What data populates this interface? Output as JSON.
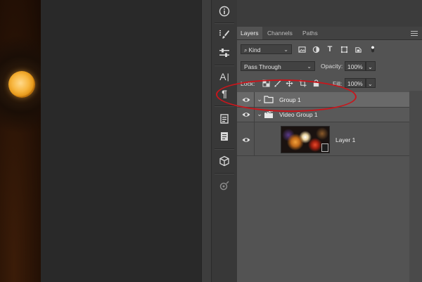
{
  "canvas": {
    "photo_desc_colors": {
      "orb": "#f3b13a",
      "background": "#080503"
    }
  },
  "toolstrip": {
    "tools": [
      {
        "name": "info-icon"
      },
      {
        "name": "brush-presets-icon"
      },
      {
        "name": "adjustment-sliders-icon"
      },
      {
        "name": "character-icon",
        "glyph": "A|"
      },
      {
        "name": "paragraph-icon",
        "glyph": "¶"
      },
      {
        "name": "glyphs-icon"
      },
      {
        "name": "notes-icon"
      },
      {
        "name": "3d-cube-icon"
      },
      {
        "name": "properties-icon"
      }
    ]
  },
  "layers_panel": {
    "tabs": [
      {
        "label": "Layers",
        "active": true
      },
      {
        "label": "Channels",
        "active": false
      },
      {
        "label": "Paths",
        "active": false
      }
    ],
    "filter": {
      "label": "Kind"
    },
    "blend_mode": "Pass Through",
    "opacity": {
      "label": "Opacity:",
      "value": "100%"
    },
    "lock_label": "Lock:",
    "fill": {
      "label": "Fill:",
      "value": "100%"
    },
    "layers": [
      {
        "name": "Group 1",
        "type": "group",
        "visible": true,
        "expanded": true,
        "selected": true
      },
      {
        "name": "Video Group 1",
        "type": "video-group",
        "visible": true,
        "expanded": true,
        "selected": false
      },
      {
        "name": "Layer 1",
        "type": "video-layer",
        "visible": true,
        "selected": false
      }
    ]
  },
  "colors": {
    "annotation_ellipse": "#c8161c",
    "panel_bg": "#535353",
    "selected_row": "#696969"
  }
}
